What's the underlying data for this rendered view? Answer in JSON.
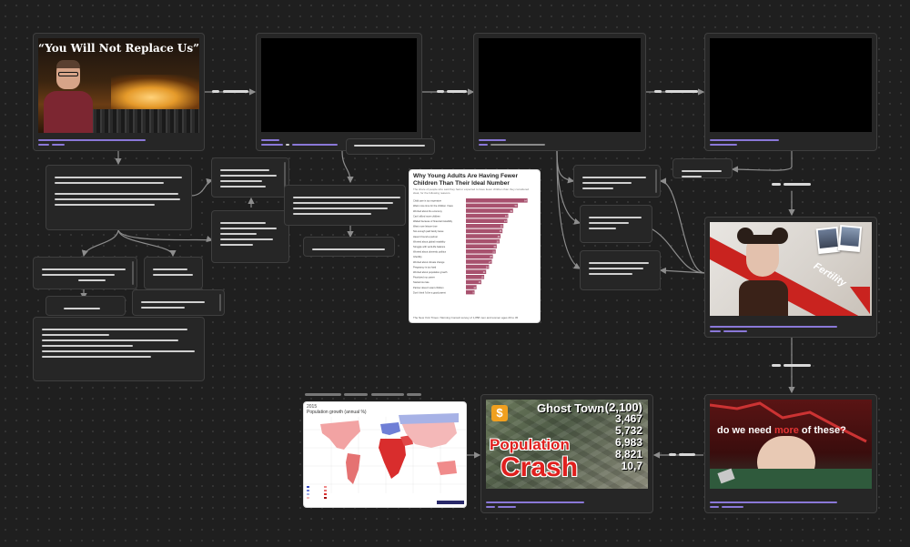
{
  "canvas": {
    "background": "#1f1f1f",
    "accent": "#8a78d8",
    "edge_color": "#8d8d8d"
  },
  "nodes": {
    "replace_us": {
      "caption": "“You Will Not Replace Us”",
      "kind": "image"
    },
    "video_1": {
      "kind": "video"
    },
    "video_2": {
      "kind": "video"
    },
    "video_3": {
      "kind": "video"
    },
    "fertility_image": {
      "banner_text": "Fertility",
      "kind": "image"
    },
    "baby_image": {
      "caption_pre": "do we need ",
      "caption_emph": "more",
      "caption_post": " of these?",
      "kind": "image"
    },
    "ghost_town_image": {
      "title": "Ghost Town",
      "number_list": [
        "(2,100)",
        "3,467",
        "5,732",
        "6,983",
        "8,821",
        "10,7"
      ],
      "headline_1": "Population",
      "headline_2": "Crash",
      "kind": "image"
    },
    "world_map": {
      "year": "2015",
      "subtitle": "Population growth (annual %)",
      "kind": "map"
    }
  },
  "chart_data": {
    "type": "bar",
    "title": "Why Young Adults Are Having Fewer Children Than Their Ideal Number",
    "subtitle": "The share of people who said they had or expected to have fewer children than they considered ideal, for the following reasons.",
    "categories": [
      "Child care is too expensive",
      "Want more time for the children I have",
      "Worried about the economy",
      "Can't afford more children",
      "Waited because of financial instability",
      "Want more leisure time",
      "Not enough paid family leave",
      "Haven't found a partner",
      "Worried about global instability",
      "Struggle with work-life balance",
      "Worried about domestic politics",
      "Infertility",
      "Worried about climate change",
      "Pregnancy is too hard",
      "Worried about population growth",
      "Prioritized my career",
      "Started too late",
      "Partner doesn't want children",
      "Don't think I'd be a good parent"
    ],
    "values": [
      64,
      54,
      49,
      44,
      43,
      39,
      38,
      36,
      35,
      32,
      31,
      28,
      27,
      24,
      21,
      19,
      16,
      11,
      9
    ],
    "xlim": [
      0,
      70
    ],
    "source": "The New York Times / Morning Consult survey of 1,858 men and women ages 20 to 45"
  }
}
